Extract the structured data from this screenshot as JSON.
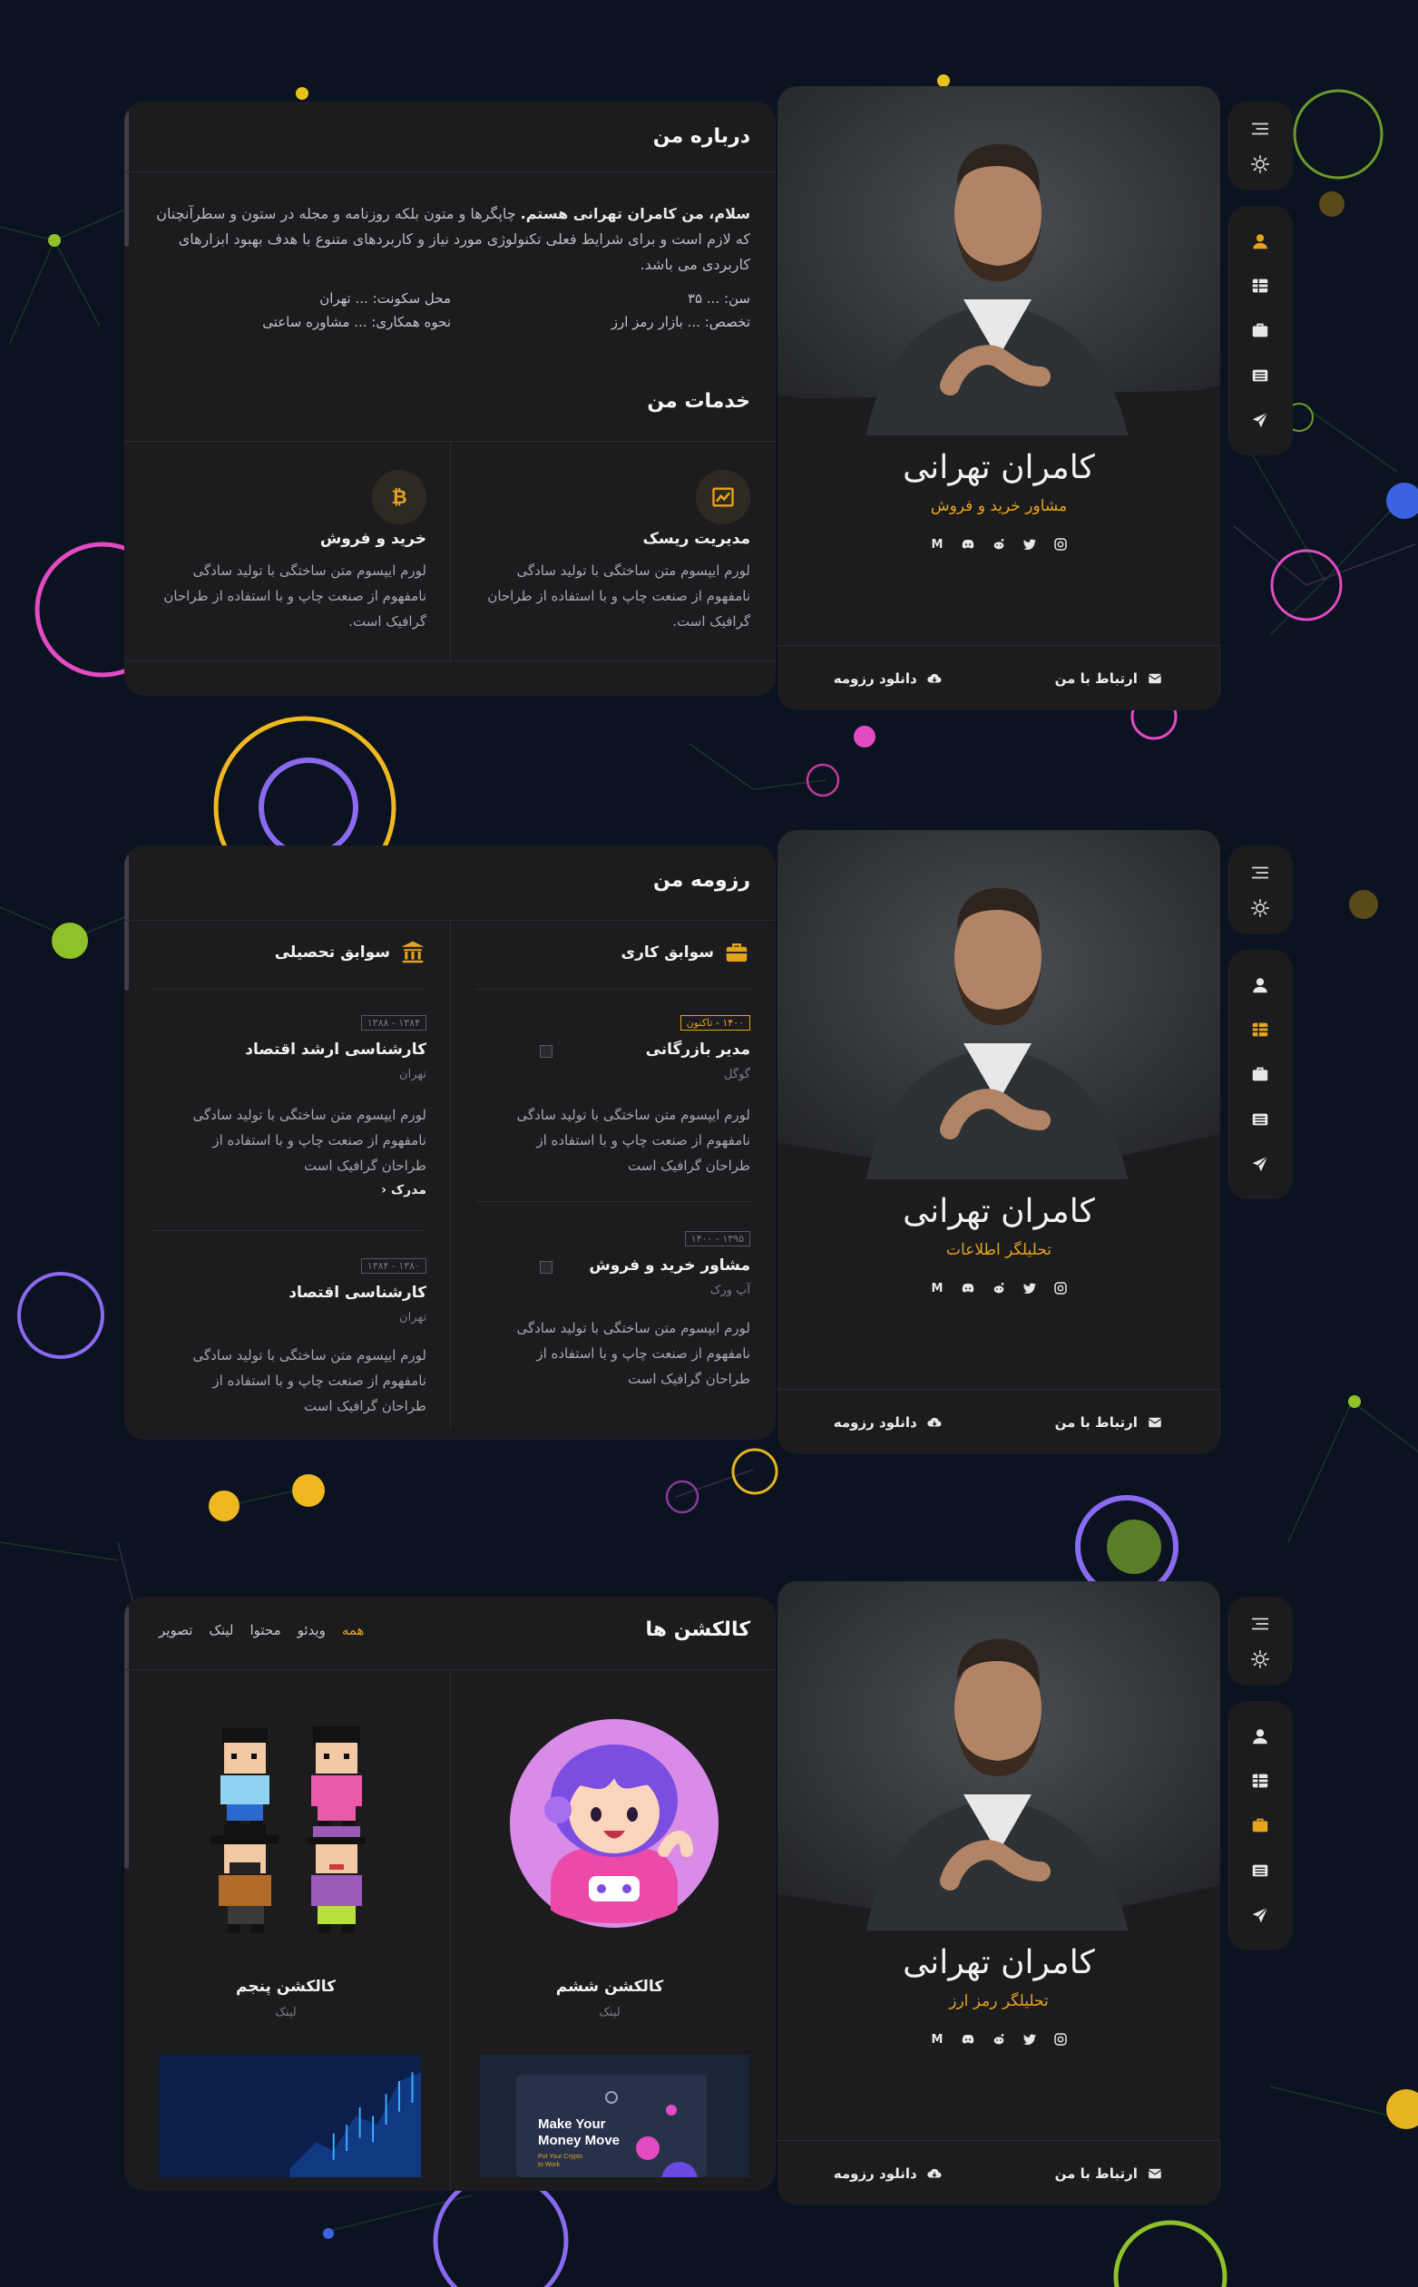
{
  "colors": {
    "accent": "#e6a31d",
    "background": "#0b1220",
    "card": "#1c1c1f"
  },
  "nav": {
    "menu_icon": "menu-icon",
    "theme_icon": "sun-icon",
    "items": [
      "user-icon",
      "table-icon",
      "briefcase-icon",
      "newspaper-icon",
      "paper-plane-icon"
    ]
  },
  "profile": {
    "name": "کامران تهرانی",
    "titles": [
      "مشاور خرید و فروش",
      "تحلیلگر اطلاعات",
      "تحلیلگر رمز ارز"
    ],
    "socials": [
      "instagram-icon",
      "twitter-icon",
      "reddit-icon",
      "discord-icon",
      "medium-icon"
    ],
    "medium_letter": "M",
    "download_label": "دانلود رزومه",
    "contact_label": "ارتباط با من"
  },
  "about": {
    "title": "درباره من",
    "intro_bold": "سلام، من کامران تهرانی هستم.",
    "intro_text": " چاپگرها و متون بلکه روزنامه و مجله در ستون و سطرآنچنان که لازم است و برای شرایط فعلی تکنولوژی مورد نیاز و کاربردهای متنوع با هدف بهبود ابزارهای کاربردی می باشد.",
    "age_label": "سن:",
    "age_value": "... ۳۵",
    "spec_label": "تخصص:",
    "spec_value": "... بازار رمز ارز",
    "location_label": "محل سکونت:",
    "location_value": "... تهران",
    "work_label": "نحوه همکاری:",
    "work_value": "... مشاوره ساعتی"
  },
  "services": {
    "title": "خدمات من",
    "items": [
      {
        "icon": "chart-line-icon",
        "title": "مدیریت ریسک",
        "text": "لورم ایپسوم متن ساختگی با تولید سادگی نامفهوم از صنعت چاپ و با استفاده از طراحان گرافیک است."
      },
      {
        "icon": "bitcoin-icon",
        "title": "خرید و فروش",
        "text": "لورم ایپسوم متن ساختگی با تولید سادگی نامفهوم از صنعت چاپ و با استفاده از طراحان گرافیک است."
      }
    ]
  },
  "resume": {
    "title": "رزومه من",
    "work": {
      "heading": "سوابق کاری",
      "items": [
        {
          "date": "۱۴۰۰ - تاکنون",
          "title": "مدیر بازرگانی",
          "org": "گوگل",
          "text": "لورم ایپسوم متن ساختگی با تولید سادگی نامفهوم از صنعت چاپ و با استفاده از طراحان گرافیک است"
        },
        {
          "date": "۱۳۹۵ - ۱۴۰۰",
          "title": "مشاور خرید و فروش",
          "org": "آپ ورک",
          "text": "لورم ایپسوم متن ساختگی با تولید سادگی نامفهوم از صنعت چاپ و با استفاده از طراحان گرافیک است"
        }
      ]
    },
    "education": {
      "heading": "سوابق تحصیلی",
      "items": [
        {
          "date": "۱۳۸۴ - ۱۳۸۸",
          "title": "کارشناسی ارشد اقتصاد",
          "org": "تهران",
          "text": "لورم ایپسوم متن ساختگی با تولید سادگی نامفهوم از صنعت چاپ و با استفاده از طراحان گرافیک است",
          "link": "مدرک"
        },
        {
          "date": "۱۳۸۰ - ۱۳۸۴",
          "title": "کارشناسی اقتصاد",
          "org": "تهران",
          "text": "لورم ایپسوم متن ساختگی با تولید سادگی نامفهوم از صنعت چاپ و با استفاده از طراحان گرافیک است"
        }
      ]
    }
  },
  "collections": {
    "title": "کالکشن ها",
    "tabs": [
      "همه",
      "ویدئو",
      "محتوا",
      "لینک",
      "تصویر"
    ],
    "items": [
      {
        "name": "کالکشن ششم",
        "type": "لینک"
      },
      {
        "name": "کالکشن پنجم",
        "type": "لینک"
      }
    ],
    "promo_title_1": "Make Your",
    "promo_title_2": "Money Move",
    "promo_sub_1": "Put Your Crypto",
    "promo_sub_2": "to Work"
  }
}
